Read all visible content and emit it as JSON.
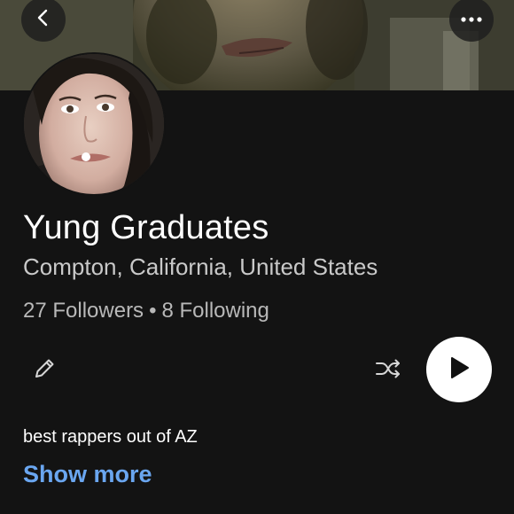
{
  "header": {
    "back_icon": "chevron-left-icon",
    "more_icon": "ellipsis-icon"
  },
  "profile": {
    "name": "Yung Graduates",
    "location": "Compton, California, United States",
    "followers": "27 Followers",
    "separator": "•",
    "following": "8 Following",
    "bio": "best rappers out of AZ",
    "show_more_label": "Show more"
  },
  "actions": {
    "edit_icon": "pencil-icon",
    "shuffle_icon": "shuffle-icon",
    "play_icon": "play-icon"
  },
  "colors": {
    "background": "#131313",
    "link": "#6aa6f0",
    "play_button": "#ffffff"
  }
}
